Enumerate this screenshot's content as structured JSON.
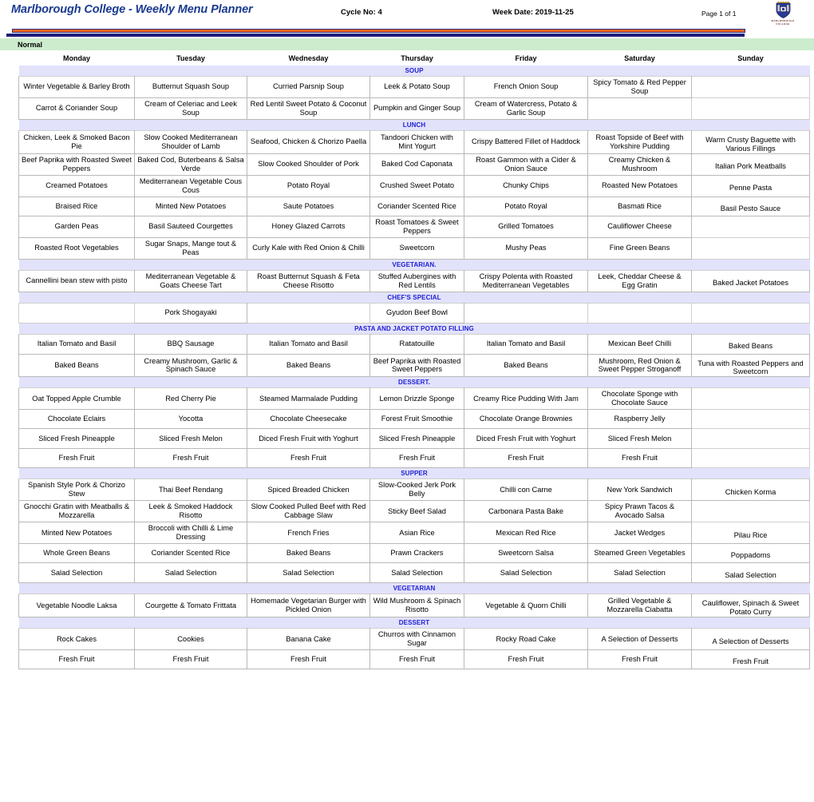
{
  "header": {
    "title": "Marlborough College - Weekly Menu Planner",
    "cycle": "Cycle No: 4",
    "week_date": "Week Date: 2019-11-25",
    "page": "Page 1 of 1",
    "crest_line1": "MARLBOROUGH",
    "crest_line2": "COLLEGE",
    "crest_icon": "shield-crest-icon",
    "band_label": "Normal",
    "accent_orange": "#f4641e",
    "accent_navy": "#1d1d7a",
    "title_blue": "#1a3a8f",
    "band_green": "#cdeccd",
    "section_bg": "#e2e2fb",
    "section_fg": "#2020d8"
  },
  "days": [
    "Monday",
    "Tuesday",
    "Wednesday",
    "Thursday",
    "Friday",
    "Saturday",
    "Sunday"
  ],
  "sections": [
    {
      "label": "SOUP",
      "rows": [
        [
          "Winter Vegetable & Barley Broth",
          "Butternut Squash Soup",
          "Curried Parsnip Soup",
          "Leek & Potato Soup",
          "French Onion Soup",
          "Spicy Tomato & Red Pepper Soup",
          ""
        ],
        [
          "Carrot & Coriander Soup",
          "Cream of Celeriac and Leek Soup",
          "Red Lentil Sweet Potato & Coconut Soup",
          "Pumpkin and Ginger Soup",
          "Cream of Watercress, Potato & Garlic Soup",
          "",
          ""
        ]
      ]
    },
    {
      "label": "LUNCH",
      "rows": [
        [
          "Chicken, Leek & Smoked Bacon Pie",
          "Slow Cooked Mediterranean Shoulder of Lamb",
          "Seafood, Chicken & Chorizo Paella",
          "Tandoori Chicken with Mint Yogurt",
          "Crispy Battered Fillet of Haddock",
          "Roast Topside of Beef with Yorkshire Pudding",
          "Warm Crusty Baguette with Various Fillings"
        ],
        [
          "Beef Paprika with Roasted Sweet Peppers",
          "Baked Cod, Buterbeans & Salsa Verde",
          "Slow Cooked Shoulder of Pork",
          "Baked Cod Caponata",
          "Roast Gammon with a Cider & Onion Sauce",
          "Creamy Chicken & Mushroom",
          "Italian Pork Meatballs"
        ],
        [
          "Creamed Potatoes",
          "Mediterranean Vegetable Cous Cous",
          "Potato Royal",
          "Crushed Sweet Potato",
          "Chunky Chips",
          "Roasted New Potatoes",
          "Penne Pasta"
        ],
        [
          "Braised Rice",
          "Minted New Potatoes",
          "Saute Potatoes",
          "Coriander Scented Rice",
          "Potato Royal",
          "Basmati Rice",
          "Basil Pesto Sauce"
        ],
        [
          "Garden Peas",
          "Basil Sauteed Courgettes",
          "Honey Glazed Carrots",
          "Roast Tomatoes & Sweet Peppers",
          "Grilled Tomatoes",
          "Cauliflower Cheese",
          ""
        ],
        [
          "Roasted Root Vegetables",
          "Sugar Snaps, Mange tout & Peas",
          "Curly Kale with Red Onion & Chilli",
          "Sweetcorn",
          "Mushy Peas",
          "Fine Green Beans",
          ""
        ]
      ]
    },
    {
      "label": "VEGETARIAN.",
      "rows": [
        [
          "Cannellini bean stew with pisto",
          "Mediterranean Vegetable & Goats Cheese Tart",
          "Roast Butternut Squash & Feta Cheese Risotto",
          "Stuffed Aubergines with Red Lentils",
          "Crispy Polenta with Roasted Mediterranean Vegetables",
          "Leek, Cheddar Cheese & Egg Gratin",
          "Baked Jacket Potatoes"
        ]
      ]
    },
    {
      "label": "CHEF'S SPECIAL",
      "rows": [
        [
          "",
          "Pork Shogayaki",
          "",
          "Gyudon Beef Bowl",
          "",
          "",
          ""
        ]
      ]
    },
    {
      "label": "PASTA AND JACKET POTATO FILLING",
      "rows": [
        [
          "Italian Tomato and Basil",
          "BBQ Sausage",
          "Italian Tomato and Basil",
          "Ratatouille",
          "Italian Tomato and Basil",
          "Mexican Beef Chilli",
          "Baked Beans"
        ],
        [
          "Baked Beans",
          "Creamy Mushroom, Garlic & Spinach Sauce",
          "Baked Beans",
          "Beef Paprika with Roasted Sweet Peppers",
          "Baked Beans",
          "Mushroom, Red Onion & Sweet Pepper Stroganoff",
          "Tuna with Roasted Peppers and Sweetcorn"
        ]
      ]
    },
    {
      "label": "DESSERT.",
      "rows": [
        [
          "Oat Topped Apple Crumble",
          "Red Cherry Pie",
          "Steamed Marmalade Pudding",
          "Lemon Drizzle Sponge",
          "Creamy Rice Pudding With Jam",
          "Chocolate Sponge with Chocolate Sauce",
          ""
        ],
        [
          "Chocolate Eclairs",
          "Yocotta",
          "Chocolate Cheesecake",
          "Forest Fruit Smoothie",
          "Chocolate Orange Brownies",
          "Raspberry Jelly",
          ""
        ],
        [
          "Sliced Fresh Pineapple",
          "Sliced Fresh Melon",
          "Diced Fresh Fruit with Yoghurt",
          "Sliced Fresh Pineapple",
          "Diced Fresh Fruit with Yoghurt",
          "Sliced Fresh Melon",
          ""
        ],
        [
          "Fresh Fruit",
          "Fresh Fruit",
          "Fresh Fruit",
          "Fresh Fruit",
          "Fresh Fruit",
          "Fresh Fruit",
          ""
        ]
      ]
    },
    {
      "label": "SUPPER",
      "rows": [
        [
          "Spanish Style Pork & Chorizo Stew",
          "Thai Beef Rendang",
          "Spiced Breaded Chicken",
          "Slow-Cooked Jerk Pork Belly",
          "Chilli con Carne",
          "New York Sandwich",
          "Chicken Korma"
        ],
        [
          "Gnocchi Gratin with Meatballs & Mozzarella",
          "Leek & Smoked Haddock Risotto",
          "Slow Cooked Pulled Beef with Red Cabbage Slaw",
          "Sticky Beef Salad",
          "Carbonara Pasta Bake",
          "Spicy Prawn Tacos & Avocado Salsa",
          ""
        ],
        [
          "Minted New Potatoes",
          "Broccoli with Chilli & Lime Dressing",
          "French Fries",
          "Asian Rice",
          "Mexican Red Rice",
          "Jacket Wedges",
          "Pilau Rice"
        ],
        [
          "Whole Green Beans",
          "Coriander Scented Rice",
          "Baked Beans",
          "Prawn Crackers",
          "Sweetcorn Salsa",
          "Steamed Green Vegetables",
          "Poppadoms"
        ],
        [
          "Salad Selection",
          "Salad Selection",
          "Salad Selection",
          "Salad Selection",
          "Salad Selection",
          "Salad Selection",
          "Salad Selection"
        ]
      ]
    },
    {
      "label": "VEGETARIAN",
      "rows": [
        [
          "Vegetable Noodle Laksa",
          "Courgette & Tomato Frittata",
          "Homemade Vegetarian Burger with Pickled Onion",
          "Wild Mushroom & Spinach Risotto",
          "Vegetable & Quorn Chilli",
          "Grilled Vegetable & Mozzarella Ciabatta",
          "Cauliflower, Spinach & Sweet Potato Curry"
        ]
      ]
    },
    {
      "label": "DESSERT",
      "rows": [
        [
          "Rock Cakes",
          "Cookies",
          "Banana Cake",
          "Churros with Cinnamon Sugar",
          "Rocky Road Cake",
          "A Selection of Desserts",
          "A Selection of Desserts"
        ],
        [
          "Fresh Fruit",
          "Fresh Fruit",
          "Fresh Fruit",
          "Fresh Fruit",
          "Fresh Fruit",
          "Fresh Fruit",
          "Fresh Fruit"
        ]
      ]
    }
  ]
}
